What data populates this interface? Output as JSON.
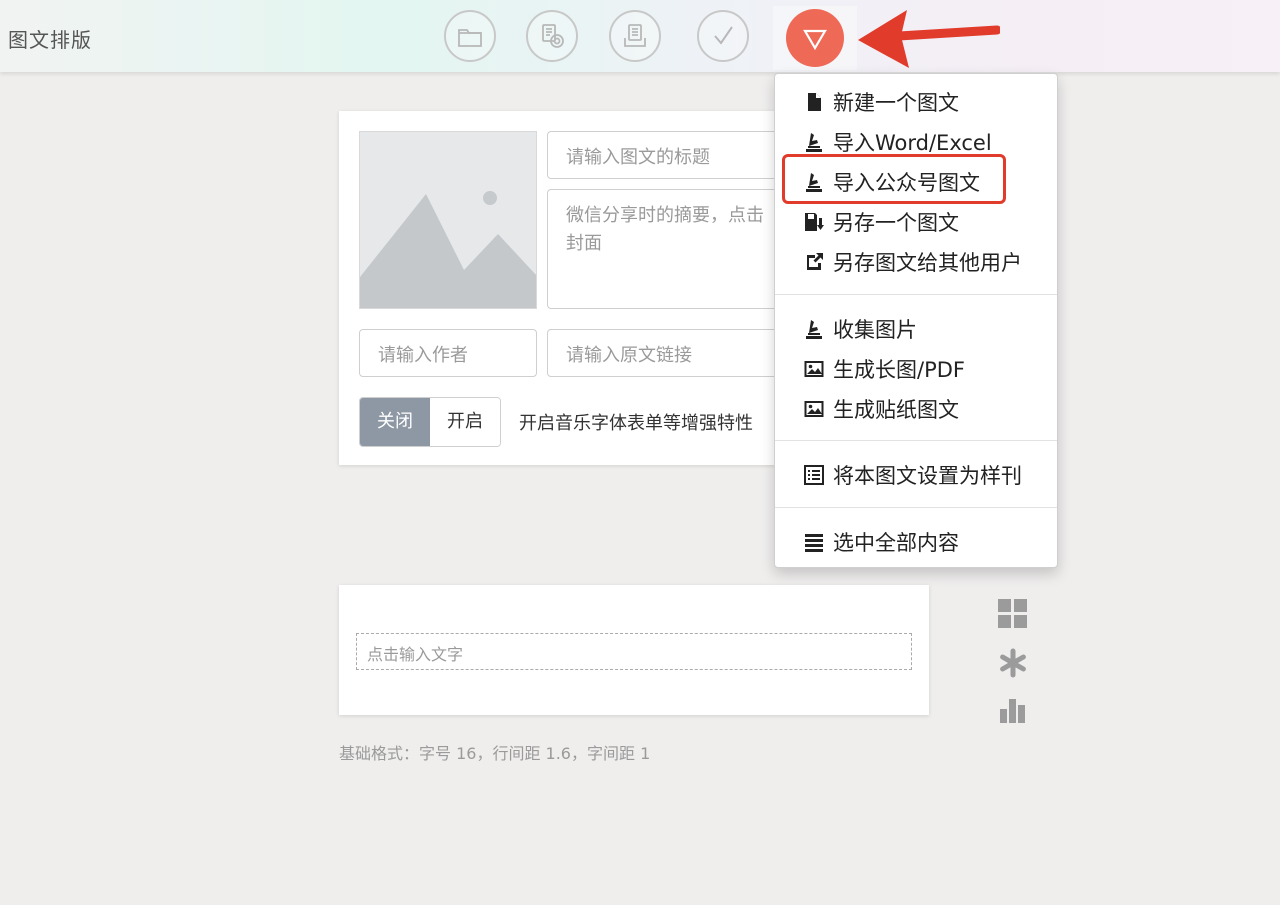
{
  "header": {
    "title": "图文排版",
    "tools": [
      "folder-icon",
      "stamp-icon",
      "clipboard-icon",
      "check-icon",
      "triangle-down-icon"
    ],
    "accent": "#ee6a56"
  },
  "article": {
    "title_placeholder": "请输入图文的标题",
    "summary_placeholder": "微信分享时的摘要，点击封面",
    "summary_line1": "微信分享时的摘要，点击",
    "summary_line2": "封面",
    "author_placeholder": "请输入作者",
    "link_placeholder": "请输入原文链接",
    "toggle_off": "关闭",
    "toggle_on": "开启",
    "toggle_desc": "开启音乐字体表单等增强特性"
  },
  "editor": {
    "text_placeholder": "点击输入文字",
    "basic_format": "基础格式：字号 16，行间距 1.6，字间距 1"
  },
  "menu": {
    "items": [
      {
        "label": "新建一个图文",
        "icon": "file-icon"
      },
      {
        "label": "导入Word/Excel",
        "icon": "import-icon"
      },
      {
        "label": "导入公众号图文",
        "icon": "import-icon"
      },
      {
        "label": "另存一个图文",
        "icon": "save-icon"
      },
      {
        "label": "另存图文给其他用户",
        "icon": "share-icon"
      },
      {
        "label": "收集图片",
        "icon": "import-icon"
      },
      {
        "label": "生成长图/PDF",
        "icon": "image-icon"
      },
      {
        "label": "生成贴纸图文",
        "icon": "image-icon"
      },
      {
        "label": "将本图文设置为样刊",
        "icon": "list-alt-icon"
      },
      {
        "label": "选中全部内容",
        "icon": "align-justify-icon"
      }
    ],
    "highlight_color": "#e13b2c"
  },
  "side_tools": [
    "grid-icon",
    "asterisk-icon",
    "bar-chart-icon"
  ]
}
